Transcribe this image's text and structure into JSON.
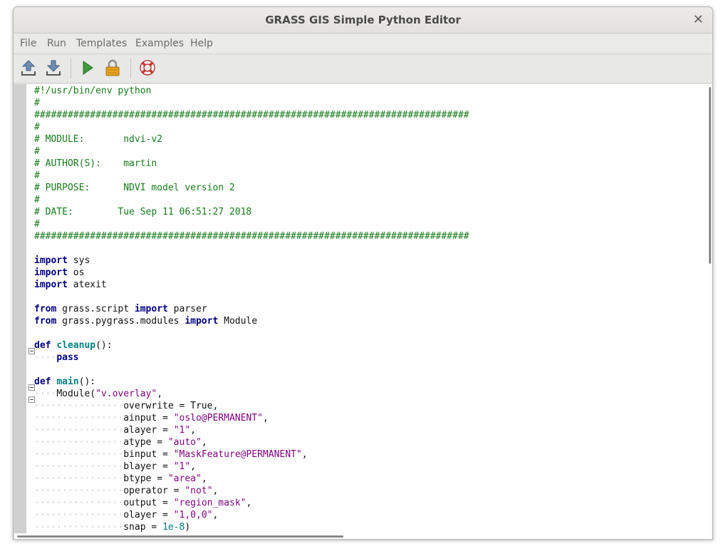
{
  "window": {
    "title": "GRASS GIS Simple Python Editor"
  },
  "menu": [
    "File",
    "Run",
    "Templates",
    "Examples",
    "Help"
  ],
  "toolbar": {
    "icons": [
      "open-file-icon",
      "save-file-icon",
      "run-play-icon",
      "lock-icon",
      "help-lifebuoy-icon"
    ]
  },
  "colors": {
    "comment": "#167b1a",
    "keyword": "#00007f",
    "def_name": "#007f7f",
    "string": "#7f007f",
    "number": "#007f7f"
  },
  "code": {
    "lines": [
      [
        [
          "c",
          "#!/usr/bin/env python"
        ]
      ],
      [
        [
          "c",
          "#"
        ]
      ],
      [
        [
          "c",
          "##############################################################################"
        ]
      ],
      [
        [
          "c",
          "#"
        ]
      ],
      [
        [
          "c",
          "# MODULE:       ndvi-v2"
        ]
      ],
      [
        [
          "c",
          "#"
        ]
      ],
      [
        [
          "c",
          "# AUTHOR(S):    martin"
        ]
      ],
      [
        [
          "c",
          "#"
        ]
      ],
      [
        [
          "c",
          "# PURPOSE:      NDVI model version 2"
        ]
      ],
      [
        [
          "c",
          "#"
        ]
      ],
      [
        [
          "c",
          "# DATE:        Tue Sep 11 06:51:27 2018"
        ]
      ],
      [
        [
          "c",
          "#"
        ]
      ],
      [
        [
          "c",
          "##############################################################################"
        ]
      ],
      [],
      [
        [
          "k",
          "import"
        ],
        [
          "t",
          " sys"
        ]
      ],
      [
        [
          "k",
          "import"
        ],
        [
          "t",
          " os"
        ]
      ],
      [
        [
          "k",
          "import"
        ],
        [
          "t",
          " atexit"
        ]
      ],
      [],
      [
        [
          "k",
          "from"
        ],
        [
          "t",
          " grass.script "
        ],
        [
          "k",
          "import"
        ],
        [
          "t",
          " parser"
        ]
      ],
      [
        [
          "k",
          "from"
        ],
        [
          "t",
          " grass.pygrass.modules "
        ],
        [
          "k",
          "import"
        ],
        [
          "t",
          " Module"
        ]
      ],
      [],
      [
        [
          "k",
          "def"
        ],
        [
          "t",
          " "
        ],
        [
          "d",
          "cleanup"
        ],
        [
          "t",
          "():"
        ]
      ],
      [
        [
          "w",
          "····"
        ],
        [
          "k",
          "pass"
        ]
      ],
      [],
      [
        [
          "k",
          "def"
        ],
        [
          "t",
          " "
        ],
        [
          "d",
          "main"
        ],
        [
          "t",
          "():"
        ]
      ],
      [
        [
          "w",
          "····"
        ],
        [
          "t",
          "Module("
        ],
        [
          "s",
          "\"v.overlay\""
        ],
        [
          "t",
          ","
        ]
      ],
      [
        [
          "w",
          "················"
        ],
        [
          "t",
          "overwrite = True,"
        ]
      ],
      [
        [
          "w",
          "················"
        ],
        [
          "t",
          "ainput = "
        ],
        [
          "s",
          "\"oslo@PERMANENT\""
        ],
        [
          "t",
          ","
        ]
      ],
      [
        [
          "w",
          "················"
        ],
        [
          "t",
          "alayer = "
        ],
        [
          "s",
          "\"1\""
        ],
        [
          "t",
          ","
        ]
      ],
      [
        [
          "w",
          "················"
        ],
        [
          "t",
          "atype = "
        ],
        [
          "s",
          "\"auto\""
        ],
        [
          "t",
          ","
        ]
      ],
      [
        [
          "w",
          "················"
        ],
        [
          "t",
          "binput = "
        ],
        [
          "s",
          "\"MaskFeature@PERMANENT\""
        ],
        [
          "t",
          ","
        ]
      ],
      [
        [
          "w",
          "················"
        ],
        [
          "t",
          "blayer = "
        ],
        [
          "s",
          "\"1\""
        ],
        [
          "t",
          ","
        ]
      ],
      [
        [
          "w",
          "················"
        ],
        [
          "t",
          "btype = "
        ],
        [
          "s",
          "\"area\""
        ],
        [
          "t",
          ","
        ]
      ],
      [
        [
          "w",
          "················"
        ],
        [
          "t",
          "operator = "
        ],
        [
          "s",
          "\"not\""
        ],
        [
          "t",
          ","
        ]
      ],
      [
        [
          "w",
          "················"
        ],
        [
          "t",
          "output = "
        ],
        [
          "s",
          "\"region_mask\""
        ],
        [
          "t",
          ","
        ]
      ],
      [
        [
          "w",
          "················"
        ],
        [
          "t",
          "olayer = "
        ],
        [
          "s",
          "\"1,0,0\""
        ],
        [
          "t",
          ","
        ]
      ],
      [
        [
          "w",
          "················"
        ],
        [
          "t",
          "snap = "
        ],
        [
          "n",
          "1e-8"
        ],
        [
          "t",
          ")"
        ]
      ]
    ]
  }
}
